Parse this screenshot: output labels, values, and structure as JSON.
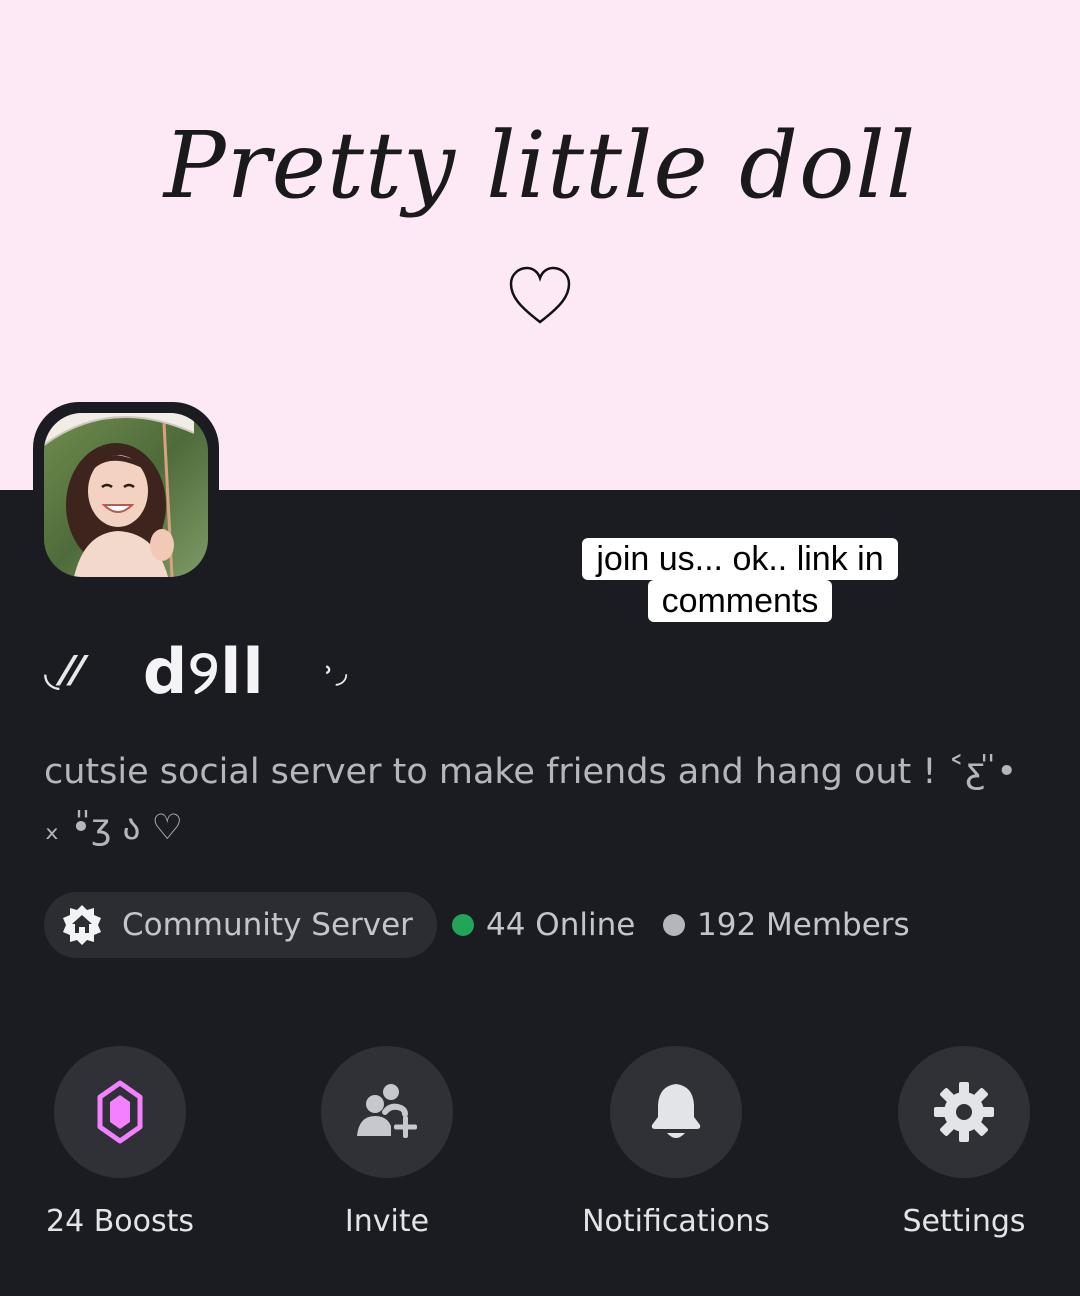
{
  "banner": {
    "title": "Pretty little doll",
    "heart": "♡"
  },
  "caption": {
    "line1": "join us... ok.. link in",
    "line2": "comments"
  },
  "server": {
    "deco_left": "◟⁄⁄",
    "name": "d୨ll",
    "deco_right": "˒◞",
    "description": "cutsie social server to make friends and hang out ! ˂ƹ ̎• ₓ •̎ʒ ა ♡"
  },
  "chip": {
    "icon": "home-icon",
    "label": "Community Server"
  },
  "stats": {
    "online": "44 Online",
    "members": "192 Members",
    "online_color": "#23a559",
    "members_color": "#b5b6bd"
  },
  "actions": [
    {
      "label": "24 Boosts",
      "icon": "boost-gem-icon"
    },
    {
      "label": "Invite",
      "icon": "add-friend-icon"
    },
    {
      "label": "Notifications",
      "icon": "bell-icon"
    },
    {
      "label": "Settings",
      "icon": "gear-icon"
    }
  ],
  "colors": {
    "banner_bg": "#fde9f6",
    "panel_bg": "#1b1c21",
    "boost_accent": "#f47fff"
  }
}
